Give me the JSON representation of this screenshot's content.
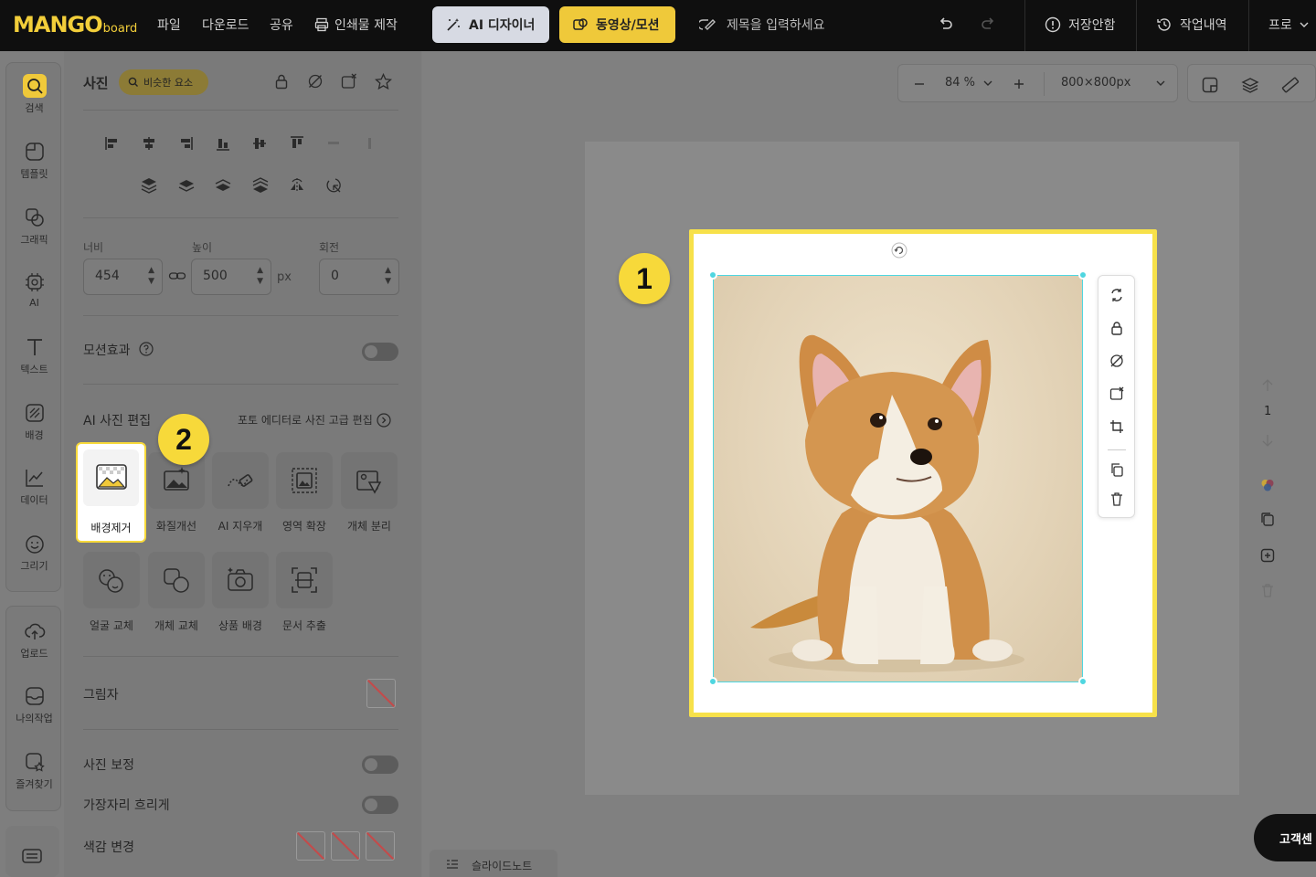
{
  "topbar": {
    "logo": "MANGO",
    "logo_sub": "board",
    "menu": [
      "파일",
      "다운로드",
      "공유",
      "인쇄물 제작"
    ],
    "ai_designer": "AI 디자이너",
    "video_motion": "동영상/모션",
    "title_placeholder": "제목을 입력하세요",
    "save_status": "저장안함",
    "history": "작업내역",
    "pro": "프로"
  },
  "nav": {
    "items": [
      "검색",
      "템플릿",
      "그래픽",
      "AI",
      "텍스트",
      "배경",
      "데이터",
      "그리기"
    ],
    "items2": [
      "업로드",
      "나의작업",
      "즐겨찾기"
    ]
  },
  "panel": {
    "title": "사진",
    "similar": "비슷한 요소",
    "width_label": "너비",
    "height_label": "높이",
    "rotation_label": "회전",
    "width_value": "454",
    "height_value": "500",
    "unit": "px",
    "rotation_value": "0",
    "motion_label": "모션효과",
    "ai_edit_title": "AI 사진 편집",
    "photo_editor_link": "포토 에디터로 사진 고급 편집",
    "tools": [
      "배경제거",
      "화질개선",
      "AI 지우개",
      "영역 확장",
      "개체 분리",
      "얼굴 교체",
      "개체 교체",
      "상품 배경",
      "문서 추출"
    ],
    "shadow_label": "그림자",
    "correction_label": "사진 보정",
    "blur_label": "가장자리 흐리게",
    "color_label": "색감 변경"
  },
  "canvas": {
    "zoom": "84 %",
    "size": "800×800px",
    "page_number": "1"
  },
  "badges": [
    "1",
    "2"
  ],
  "footer": {
    "slide_note": "슬라이드노트",
    "customer_center": "고객센"
  },
  "colors": {
    "accent": "#f0c93a",
    "highlight": "#f7e14a",
    "selection": "#4fd6e0"
  }
}
